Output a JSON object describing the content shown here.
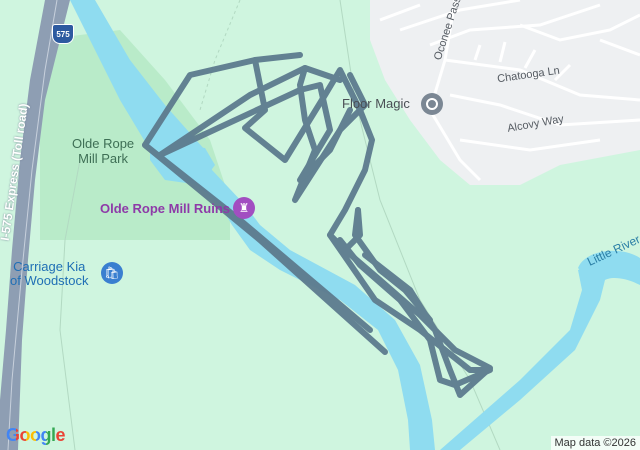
{
  "map": {
    "highway_shield": "575",
    "highway_label": "I-575 Express (Toll road)",
    "park_label_line1": "Olde Rope",
    "park_label_line2": "Mill Park",
    "ruins_label": "Olde Rope Mill Ruins",
    "dealer_label_line1": "Carriage Kia",
    "dealer_label_line2": "of Woodstock",
    "floor_magic_label": "Floor Magic",
    "streets": {
      "oconee": "Oconee Pass",
      "chatooga": "Chatooga Ln",
      "alcovy": "Alcovy Way"
    },
    "river_label": "Little River",
    "google_logo": "Google",
    "attribution": "Map data ©2026",
    "colors": {
      "land": "#cff5df",
      "park": "#b9ebc9",
      "water": "#8fdcf0",
      "residential": "#eef0f2",
      "highway": "#8e9eb3",
      "route": "#5d7b8e"
    }
  }
}
